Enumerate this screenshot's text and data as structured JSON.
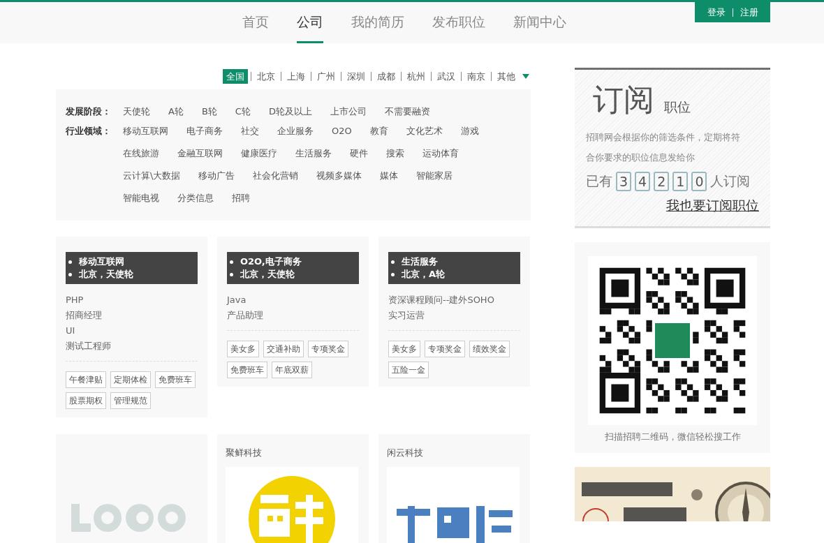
{
  "nav": {
    "items": [
      {
        "label": "首页",
        "selected": false
      },
      {
        "label": "公司",
        "selected": true
      },
      {
        "label": "我的简历",
        "selected": false
      },
      {
        "label": "发布职位",
        "selected": false
      },
      {
        "label": "新闻中心",
        "selected": false
      }
    ],
    "login": "登录",
    "register": "注册"
  },
  "cities": [
    {
      "label": "全国",
      "selected": true
    },
    {
      "label": "北京",
      "selected": false
    },
    {
      "label": "上海",
      "selected": false
    },
    {
      "label": "广州",
      "selected": false
    },
    {
      "label": "深圳",
      "selected": false
    },
    {
      "label": "成都",
      "selected": false
    },
    {
      "label": "杭州",
      "selected": false
    },
    {
      "label": "武汉",
      "selected": false
    },
    {
      "label": "南京",
      "selected": false
    },
    {
      "label": "其他",
      "selected": false
    }
  ],
  "filters": [
    {
      "label": "发展阶段：",
      "options": [
        "天使轮",
        "A轮",
        "B轮",
        "C轮",
        "D轮及以上",
        "上市公司",
        "不需要融资"
      ]
    },
    {
      "label": "行业领域：",
      "options": [
        "移动互联网",
        "电子商务",
        "社交",
        "企业服务",
        "O2O",
        "教育",
        "文化艺术",
        "游戏",
        "在线旅游",
        "金融互联网",
        "健康医疗",
        "生活服务",
        "硬件",
        "搜索",
        "运动体育",
        "云计算\\大数据",
        "移动广告",
        "社会化营销",
        "视频多媒体",
        "媒体",
        "智能家居",
        "智能电视",
        "分类信息",
        "招聘"
      ]
    }
  ],
  "companies": [
    {
      "tags": [
        "移动互联网",
        "北京，天使轮"
      ],
      "jobs": [
        "PHP",
        "招商经理",
        "UI",
        "测试工程师"
      ],
      "perks": [
        "午餐津贴",
        "定期体检",
        "免费班车",
        "股票期权",
        "管理规范"
      ]
    },
    {
      "tags": [
        "O2O,电子商务",
        "北京，天使轮"
      ],
      "jobs": [
        "Java",
        "产品助理"
      ],
      "perks": [
        "美女多",
        "交通补助",
        "专项奖金",
        "免费班车",
        "年底双薪"
      ]
    },
    {
      "tags": [
        "生活服务",
        "北京，A轮"
      ],
      "jobs": [
        "资深课程顾问--建外SOHO",
        "实习运营"
      ],
      "perks": [
        "美女多",
        "专项奖金",
        "绩效奖金",
        "五险一金"
      ]
    }
  ],
  "more_companies": [
    {
      "logo": {
        "kind": "picture"
      }
    },
    {
      "name": "聚鲜科技",
      "logo": {
        "kind": "picture"
      }
    },
    {
      "name": "闲云科技",
      "logo": {
        "kind": "picture"
      }
    }
  ],
  "subscribe": {
    "title": "订阅",
    "subtitle": "职位",
    "description": "招聘网会根据你的筛选条件，定期将符合你要求的职位信息发给你",
    "prefix": "已有",
    "digits": [
      "3",
      "4",
      "2",
      "1",
      "0"
    ],
    "suffix": "人订阅",
    "link": "我也要订阅职位"
  },
  "qr": {
    "caption": "扫描招聘二维码，微信轻松搜工作"
  },
  "banner": {
    "kind": "picture"
  }
}
